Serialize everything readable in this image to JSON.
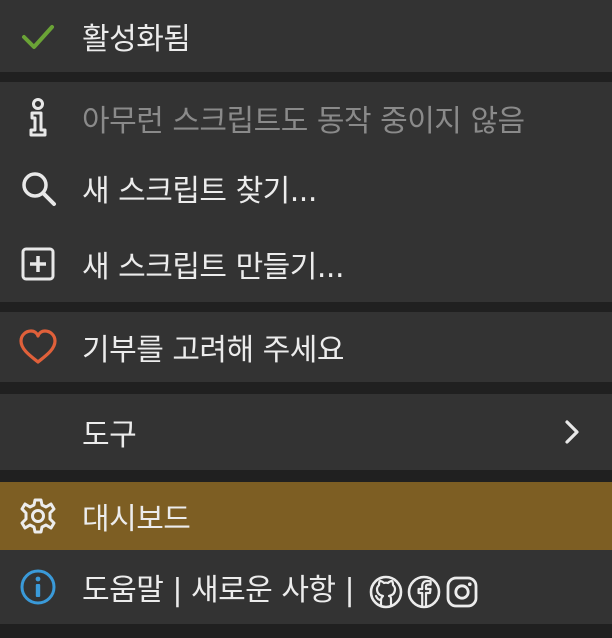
{
  "menu": {
    "enabled_label": "활성화됨",
    "no_scripts_label": "아무런 스크립트도 동작 중이지 않음",
    "find_scripts_label": "새 스크립트 찾기...",
    "create_script_label": "새 스크립트 만들기...",
    "donate_label": "기부를 고려해 주세요",
    "tools_label": "도구",
    "dashboard_label": "대시보드",
    "help_label": "도움말 | 새로운 사항 |"
  },
  "colors": {
    "check": "#6aa336",
    "heart": "#e0603a",
    "highlight": "#7d5e23",
    "info": "#3a9ad9"
  },
  "icons": {
    "enabled": "check-icon",
    "no_scripts": "info-icon",
    "find": "search-icon",
    "create": "plus-square-icon",
    "donate": "heart-icon",
    "tools_chevron": "chevron-right-icon",
    "dashboard": "gear-icon",
    "help": "info-circle-icon",
    "github": "github-icon",
    "facebook": "facebook-icon",
    "instagram": "instagram-icon"
  }
}
